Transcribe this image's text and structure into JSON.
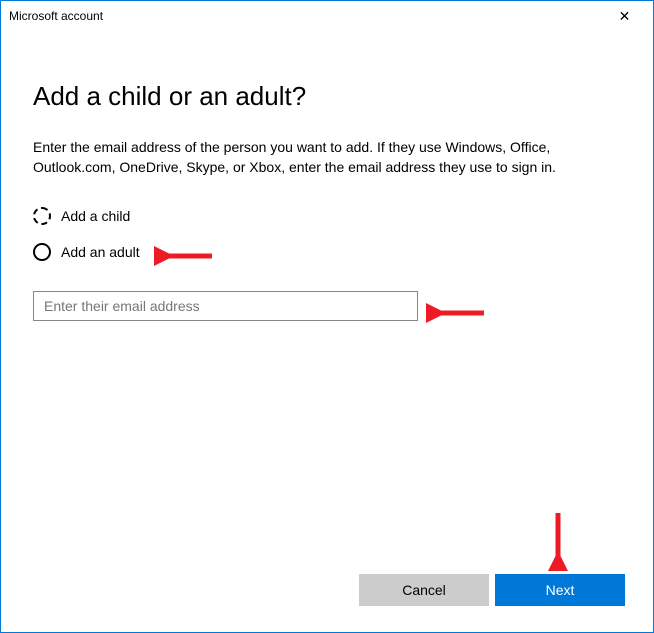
{
  "titlebar": {
    "title": "Microsoft account",
    "close": "✕"
  },
  "heading": "Add a child or an adult?",
  "description": "Enter the email address of the person you want to add. If they use Windows, Office, Outlook.com, OneDrive, Skype, or Xbox, enter the email address they use to sign in.",
  "radios": {
    "child": "Add a child",
    "adult": "Add an adult"
  },
  "email": {
    "placeholder": "Enter their email address",
    "value": ""
  },
  "buttons": {
    "cancel": "Cancel",
    "next": "Next"
  },
  "colors": {
    "accent": "#0078d7",
    "arrow": "#ed1c24"
  }
}
